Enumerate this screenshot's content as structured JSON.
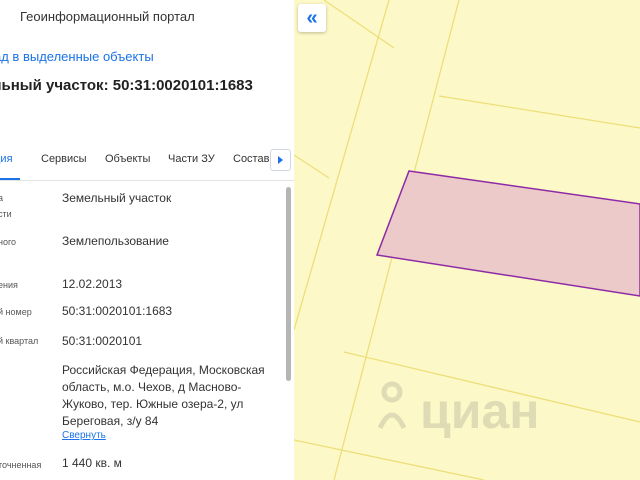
{
  "header": {
    "portal_title": "Геоинформационный портал"
  },
  "panel": {
    "back_link": "ад в выделенные объекты",
    "object_title": "льный участок: 50:31:0020101:1683"
  },
  "tabs": [
    {
      "label": "ация",
      "active": true
    },
    {
      "label": "Сервисы"
    },
    {
      "label": "Объекты"
    },
    {
      "label": "Части ЗУ"
    },
    {
      "label": "Состав"
    }
  ],
  "rows": [
    {
      "label": [
        "а",
        "сти"
      ],
      "value": "Земельный участок"
    },
    {
      "label": [
        "ного"
      ],
      "value": "Землепользование"
    },
    {
      "label": [
        "ения"
      ],
      "value": "12.02.2013"
    },
    {
      "label": [
        "й номер"
      ],
      "value": "50:31:0020101:1683"
    },
    {
      "label": [
        "й квартал"
      ],
      "value": "50:31:0020101"
    },
    {
      "label": [
        ""
      ],
      "value": "Российская Федерация, Московская область, м.о. Чехов, д Масново-Жуково, тер. Южные озера-2, ул Береговая, з/у 84"
    },
    {
      "label": [
        "точненная"
      ],
      "value": "1 440 кв. м"
    }
  ],
  "collapse_link": "Свернуть",
  "map": {
    "collapse_icon": "«",
    "watermark": "циан",
    "colors": {
      "background": "#fdf8c8",
      "lines": "#ecdf7a",
      "parcel_fill": "#eccaca",
      "parcel_stroke": "#8e2aa5"
    }
  }
}
